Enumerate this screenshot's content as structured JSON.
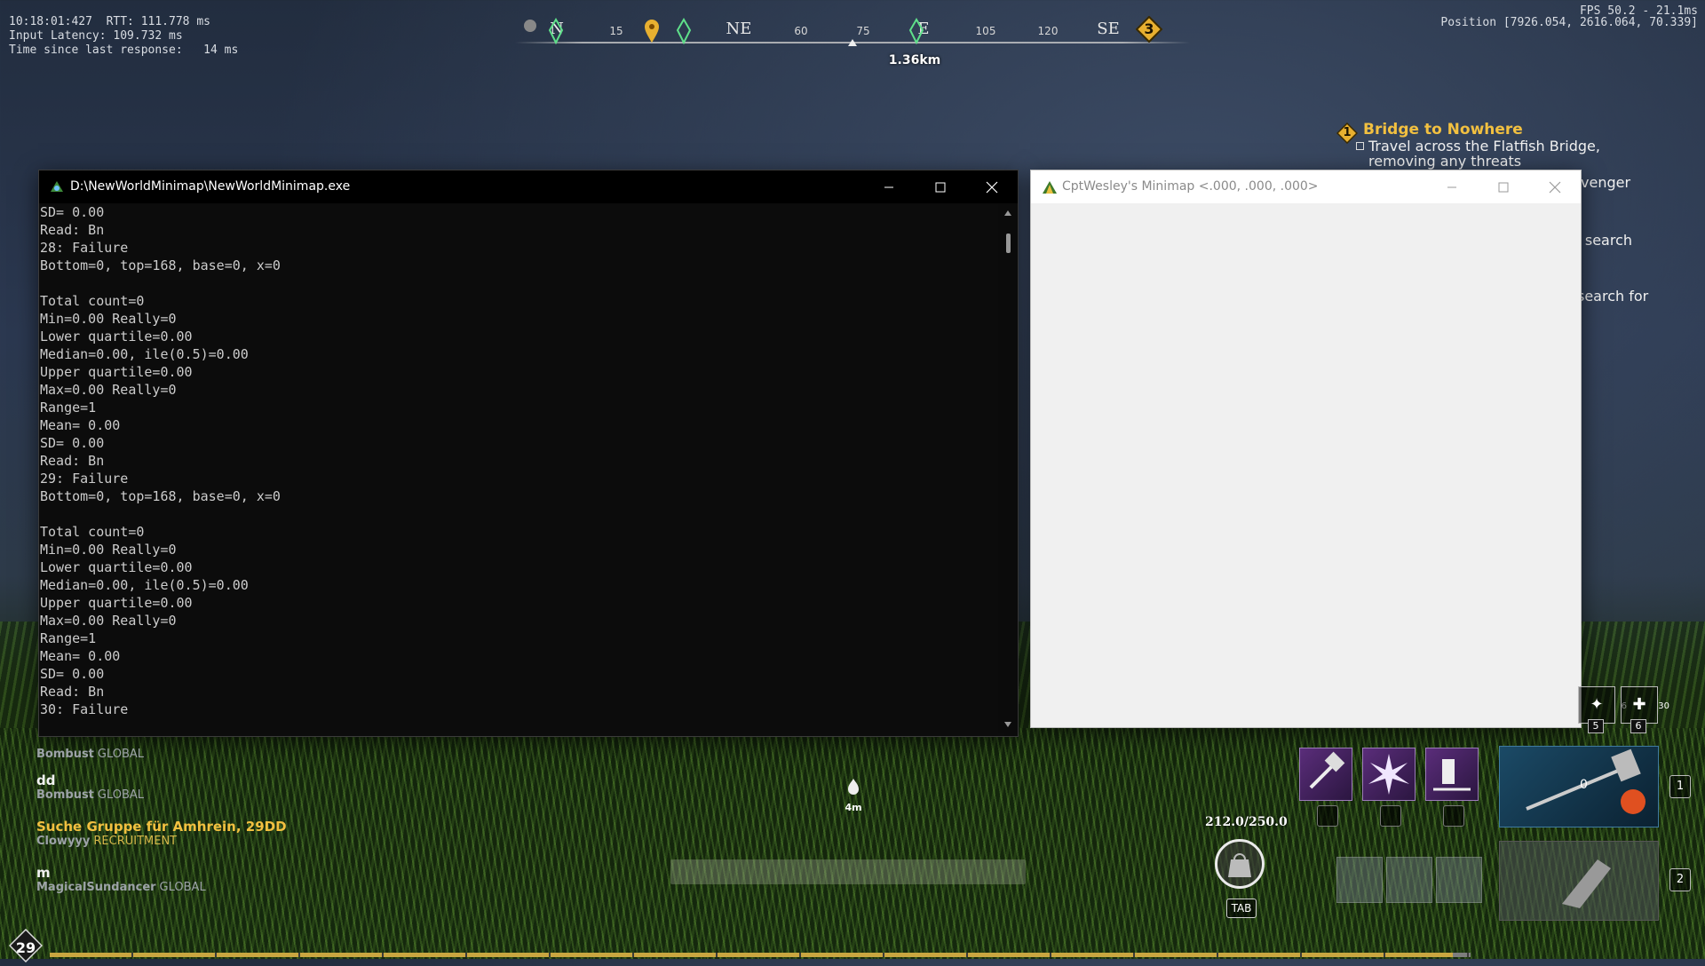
{
  "hud": {
    "net_stats": "10:18:01:427  RTT: 111.778 ms\nInput Latency: 109.732 ms\nTime since last response:   14 ms",
    "fps": "FPS 50.2 - 21.1ms",
    "position": "Position [7926.054, 2616.064, 70.339]",
    "compass": {
      "labels": [
        "N",
        "15",
        "NE",
        "60",
        "75",
        "E",
        "105",
        "120",
        "SE"
      ],
      "distance": "1.36km",
      "marker_number": "3"
    },
    "quest": {
      "number": "1",
      "title": "Bridge to Nowhere",
      "objective": "Travel across the Flatfish Bridge, removing any threats",
      "frag1": "venger",
      "frag2": "o search",
      "frag3": "search for"
    },
    "level": "29",
    "center_timer": "4m",
    "ammo": "212.0/250.0",
    "tab_key": "TAB",
    "weapon1_slot": "1",
    "weapon2_slot": "2",
    "weapon1_count": "0",
    "quick_slots": [
      {
        "key": "5",
        "count": "6"
      },
      {
        "key": "6",
        "count": "30"
      }
    ]
  },
  "console_window": {
    "title": "D:\\NewWorldMinimap\\NewWorldMinimap.exe",
    "lines": [
      "SD= 0.00",
      "Read: Bn",
      "28: Failure",
      "Bottom=0, top=168, base=0, x=0",
      "",
      "Total count=0",
      "Min=0.00 Really=0",
      "Lower quartile=0.00",
      "Median=0.00, ile(0.5)=0.00",
      "Upper quartile=0.00",
      "Max=0.00 Really=0",
      "Range=1",
      "Mean= 0.00",
      "SD= 0.00",
      "Read: Bn",
      "29: Failure",
      "Bottom=0, top=168, base=0, x=0",
      "",
      "Total count=0",
      "Min=0.00 Really=0",
      "Lower quartile=0.00",
      "Median=0.00, ile(0.5)=0.00",
      "Upper quartile=0.00",
      "Max=0.00 Really=0",
      "Range=1",
      "Mean= 0.00",
      "SD= 0.00",
      "Read: Bn",
      "30: Failure"
    ]
  },
  "minimap_window": {
    "title": "CptWesley's Minimap <.000, .000, .000>"
  },
  "chat": [
    {
      "message": "dd",
      "user": "Bombust",
      "channel": "GLOBAL",
      "highlight": false
    },
    {
      "message": "Suche Gruppe für Amhrein, 29DD",
      "user": "Clowyyy",
      "channel": "RECRUITMENT",
      "highlight": true
    },
    {
      "message": "m",
      "user": "MagicalSundancer",
      "channel": "GLOBAL",
      "highlight": false
    }
  ],
  "chat_partial": {
    "user": "Bombust",
    "channel": "GLOBAL"
  },
  "colors": {
    "quest_title": "#f2c040",
    "recruit_channel": "#d6b84a",
    "console_bg": "#0c0c0c",
    "console_text": "#cccccc"
  }
}
